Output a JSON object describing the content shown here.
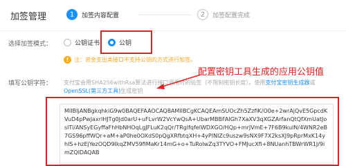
{
  "header": {
    "title": "加签管理",
    "steps": [
      {
        "num": "1",
        "label": "加签内容配置"
      },
      {
        "num": "2",
        "label": "加签配置完成"
      }
    ]
  },
  "form": {
    "mode_label": "选择加签模式：",
    "mode_options": [
      {
        "label": "公钥证书",
        "checked": false
      },
      {
        "label": "公钥",
        "checked": true
      }
    ],
    "warning_icon": "!",
    "warning_text": "注：资金支出类接口不支持公钥的方式进行加签。",
    "key_label": "填写公钥字符：",
    "key_desc_prefix": "支付宝会用SHA256withRsa算法进行接口调用时的验签（不限制密钥长度）。使用",
    "key_desc_link1": "支付宝密钥生成器",
    "key_desc_mid": "或",
    "key_desc_link2": "OpenSSL(第三方工具)",
    "key_desc_suffix": "生成密钥",
    "key_value": "MIIBIjANBgkqhkiG9w0BAQEFAAOCAQ8AMIIBCgKCAQEAmSUOcZh5ZzfiK/O0e+2wrAjQvE5GpcdKVuD4pPwJaxrlHJTg0Jd0arU+uFLvrW2VcYwQsA+UbarMBBFAIGh7XaXV3qXGZArfanQtQfXmUatJoslTi/ANSyEGyffaFhHbNHOqLgJFLuK2qQr/TRglfqfelWDXGO/HQp+mrJVmE+7F6B9kulN/4WNR2eB7GS96pffWQr+aM+aP0he0OXdS0pQgXRfbtqXH+4yPINIZc9uszw9sNX9F7X2ksXJ9pRprMxK14yhIS+hzEjYezOQD9IkqZMV59fiMaKr14mG+o+TuRolwZq3TYVO+FMJucXfi+8NUanhTBWrWR1J/9imZQIDAQAB"
  },
  "annotation": {
    "text": "配置密钥工具生成的应用公钥值"
  },
  "colors": {
    "accent": "#1890ff",
    "highlight": "#e02020",
    "warning": "#faad14"
  }
}
